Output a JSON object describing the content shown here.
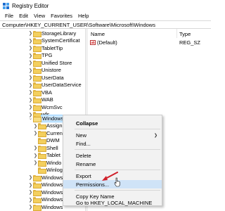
{
  "window": {
    "title": "Registry Editor"
  },
  "menubar": {
    "items": [
      "File",
      "Edit",
      "View",
      "Favorites",
      "Help"
    ]
  },
  "address": {
    "path": "Computer\\HKEY_CURRENT_USER\\Software\\Microsoft\\Windows"
  },
  "tree": {
    "items": [
      {
        "label": "StorageLibrary"
      },
      {
        "label": "SystemCertificat"
      },
      {
        "label": "TabletTip"
      },
      {
        "label": "TPG"
      },
      {
        "label": "Unified Store"
      },
      {
        "label": "Unistore"
      },
      {
        "label": "UserData"
      },
      {
        "label": "UserDataService"
      },
      {
        "label": "VBA"
      },
      {
        "label": "WAB"
      },
      {
        "label": "WcmSvc"
      },
      {
        "label": "wfs"
      },
      {
        "label": "Windows"
      },
      {
        "label": "Assign"
      },
      {
        "label": "CurrentV"
      },
      {
        "label": "DWM"
      },
      {
        "label": "Shell"
      },
      {
        "label": "Tablet"
      },
      {
        "label": "Windo"
      },
      {
        "label": "Winlog"
      },
      {
        "label": "Windows"
      },
      {
        "label": "Windows"
      },
      {
        "label": "Windows"
      },
      {
        "label": "Windows"
      },
      {
        "label": "Windows"
      }
    ]
  },
  "values": {
    "col_name": "Name",
    "col_type": "Type",
    "rows": [
      {
        "name": "(Default)",
        "type": "REG_SZ",
        "icon": "string-value-icon"
      }
    ]
  },
  "context_menu": {
    "items": [
      {
        "label": "Collapse"
      },
      {
        "label": "New"
      },
      {
        "label": "Find..."
      },
      {
        "label": "Delete"
      },
      {
        "label": "Rename"
      },
      {
        "label": "Export"
      },
      {
        "label": "Permissions..."
      },
      {
        "label": "Copy Key Name"
      },
      {
        "label": "Go to HKEY_LOCAL_MACHINE"
      }
    ]
  },
  "colors": {
    "selection": "#cce8ff",
    "menu_bg": "#f2f2f2",
    "menu_highlight": "#cfe3f7",
    "arrow": "#d0202a",
    "folder": "#f3cf5e"
  }
}
